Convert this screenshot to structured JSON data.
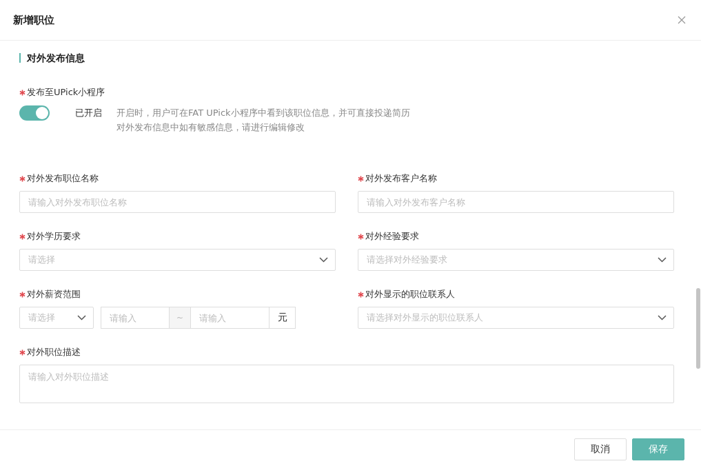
{
  "dialog": {
    "title": "新增职位"
  },
  "section": {
    "title": "对外发布信息"
  },
  "publish": {
    "label": "发布至UPick小程序",
    "required": true,
    "on": true,
    "status": "已开启",
    "hints": [
      "开启时，用户可在FAT UPick小程序中看到该职位信息，并可直接投递简历",
      "对外发布信息中如有敏感信息，请进行编辑修改"
    ]
  },
  "fields": [
    {
      "kind": "input",
      "label": "对外发布职位名称",
      "required": true,
      "placeholder": "请输入对外发布职位名称"
    },
    {
      "kind": "input",
      "label": "对外发布客户名称",
      "required": true,
      "placeholder": "请输入对外发布客户名称"
    },
    {
      "kind": "select",
      "label": "对外学历要求",
      "required": true,
      "placeholder": "请选择"
    },
    {
      "kind": "select",
      "label": "对外经验要求",
      "required": true,
      "placeholder": "请选择对外经验要求"
    },
    {
      "kind": "salary",
      "label": "对外薪资范围",
      "required": true,
      "select_placeholder": "请选择",
      "min_placeholder": "请输入",
      "separator": "~",
      "max_placeholder": "请输入",
      "unit": "元"
    },
    {
      "kind": "select",
      "label": "对外显示的职位联系人",
      "required": true,
      "placeholder": "请选择对外显示的职位联系人"
    },
    {
      "kind": "textarea",
      "label": "对外职位描述",
      "required": true,
      "placeholder": "请输入对外职位描述"
    }
  ],
  "buttons": [
    {
      "label": "取消",
      "kind": "secondary"
    },
    {
      "label": "保存",
      "kind": "primary"
    }
  ]
}
